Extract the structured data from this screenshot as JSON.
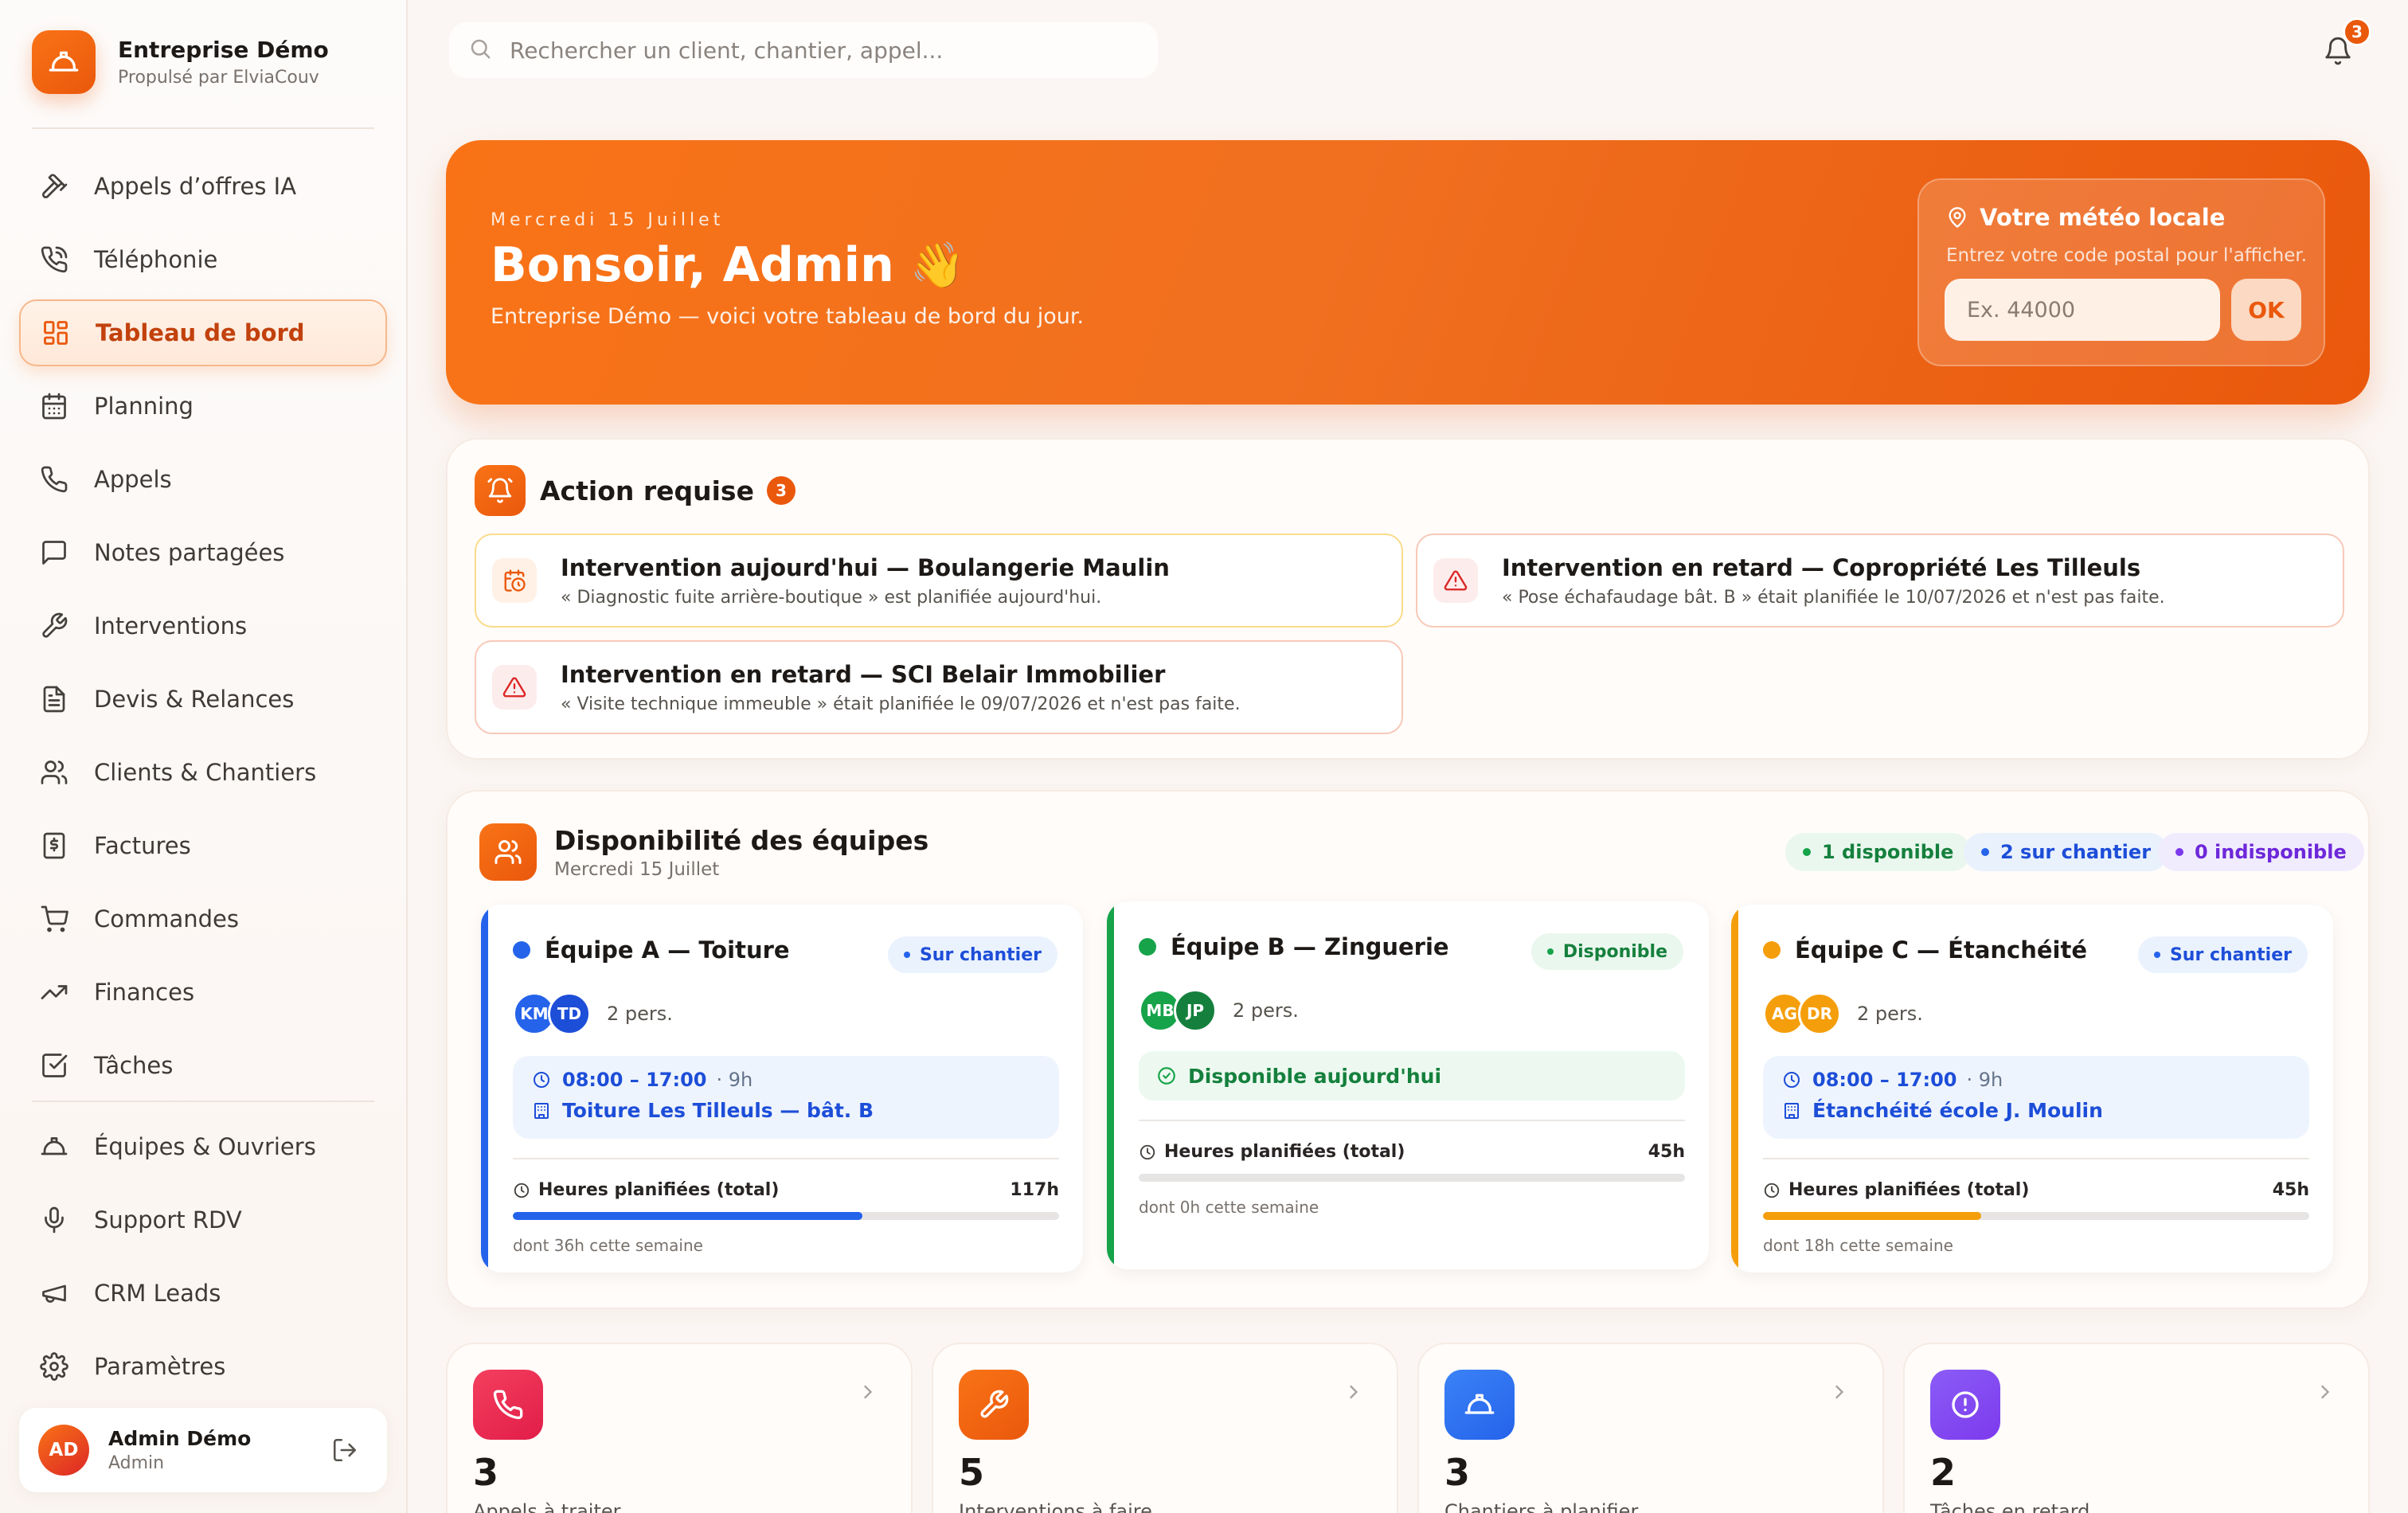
{
  "brand": {
    "name": "Entreprise Démo",
    "powered_by": "Propulsé par ElviaCouv"
  },
  "nav": [
    {
      "label": "Appels d’offres IA",
      "icon": "hammer-icon"
    },
    {
      "label": "Téléphonie",
      "icon": "phone-call-icon"
    },
    {
      "label": "Tableau de bord",
      "icon": "dashboard-icon",
      "active": true
    },
    {
      "label": "Planning",
      "icon": "calendar-icon"
    },
    {
      "label": "Appels",
      "icon": "phone-icon"
    },
    {
      "label": "Notes partagées",
      "icon": "message-icon"
    },
    {
      "label": "Interventions",
      "icon": "wrench-icon"
    },
    {
      "label": "Devis & Relances",
      "icon": "document-icon"
    },
    {
      "label": "Clients & Chantiers",
      "icon": "users-icon"
    },
    {
      "label": "Factures",
      "icon": "invoice-icon"
    },
    {
      "label": "Commandes",
      "icon": "cart-icon"
    },
    {
      "label": "Finances",
      "icon": "trend-icon"
    },
    {
      "label": "Tâches",
      "icon": "checkbox-icon"
    },
    {
      "label": "Équipes & Ouvriers",
      "icon": "helmet-icon"
    },
    {
      "label": "Support RDV",
      "icon": "microphone-icon"
    },
    {
      "label": "CRM Leads",
      "icon": "megaphone-icon"
    },
    {
      "label": "Paramètres",
      "icon": "gear-icon"
    }
  ],
  "user": {
    "initials": "AD",
    "name": "Admin Démo",
    "role": "Admin"
  },
  "search": {
    "placeholder": "Rechercher un client, chantier, appel..."
  },
  "notifications": {
    "count": "3"
  },
  "hero": {
    "date": "Mercredi 15 Juillet",
    "greeting": "Bonsoir, Admin",
    "emoji": "👋",
    "subtitle": "Entreprise Démo — voici votre tableau de bord du jour."
  },
  "weather": {
    "title": "Votre météo locale",
    "hint": "Entrez votre code postal pour l'afficher.",
    "placeholder": "Ex. 44000",
    "button": "OK"
  },
  "actions": {
    "title": "Action requise",
    "count": "3",
    "items": [
      {
        "title": "Intervention aujourd'hui — Boulangerie Maulin",
        "desc": "« Diagnostic fuite arrière-boutique » est planifiée aujourd'hui.",
        "kind": "today"
      },
      {
        "title": "Intervention en retard — Copropriété Les Tilleuls",
        "desc": "« Pose échafaudage bât. B » était planifiée le 10/07/2026 et n'est pas faite.",
        "kind": "late"
      },
      {
        "title": "Intervention en retard — SCI Belair Immobilier",
        "desc": "« Visite technique immeuble » était planifiée le 09/07/2026 et n'est pas faite.",
        "kind": "late"
      }
    ]
  },
  "teams": {
    "title": "Disponibilité des équipes",
    "date": "Mercredi 15 Juillet",
    "summary": {
      "available": "1 disponible",
      "on_site": "2 sur chantier",
      "unavailable": "0 indisponible"
    },
    "cards": [
      {
        "name": "Équipe A — Toiture",
        "color": "#2563eb",
        "status": "Sur chantier",
        "members": [
          "KM",
          "TD"
        ],
        "member_colors": [
          "#2563eb",
          "#1d4ed8"
        ],
        "count": "2 pers.",
        "time": "08:00 – 17:00",
        "duration": "· 9h",
        "site": "Toiture Les Tilleuls — bât. B",
        "hours_label": "Heures planifiées (total)",
        "hours": "117h",
        "progress": 0.64,
        "week": "dont 36h cette semaine"
      },
      {
        "name": "Équipe B — Zinguerie",
        "color": "#16a34a",
        "status": "Disponible",
        "members": [
          "MB",
          "JP"
        ],
        "member_colors": [
          "#16a34a",
          "#15803d"
        ],
        "count": "2 pers.",
        "free": "Disponible aujourd'hui",
        "hours_label": "Heures planifiées (total)",
        "hours": "45h",
        "progress": 0,
        "week": "dont 0h cette semaine"
      },
      {
        "name": "Équipe C — Étanchéité",
        "color": "#f59e0b",
        "status": "Sur chantier",
        "members": [
          "AG",
          "DR"
        ],
        "member_colors": [
          "#f59e0b",
          "#f59e0b"
        ],
        "count": "2 pers.",
        "time": "08:00 – 17:00",
        "duration": "· 9h",
        "site": "Étanchéité école J. Moulin",
        "hours_label": "Heures planifiées (total)",
        "hours": "45h",
        "progress": 0.4,
        "week": "dont 18h cette semaine"
      }
    ]
  },
  "stats": [
    {
      "value": "3",
      "label": "Appels à traiter",
      "icon": "phone-icon",
      "color": "#e11d48"
    },
    {
      "value": "5",
      "label": "Interventions à faire",
      "icon": "wrench-icon",
      "color": "#ea580c"
    },
    {
      "value": "3",
      "label": "Chantiers à planifier",
      "icon": "helmet-icon",
      "color": "#2563eb"
    },
    {
      "value": "2",
      "label": "Tâches en retard",
      "icon": "alert-icon",
      "color": "#7c3aed"
    }
  ]
}
